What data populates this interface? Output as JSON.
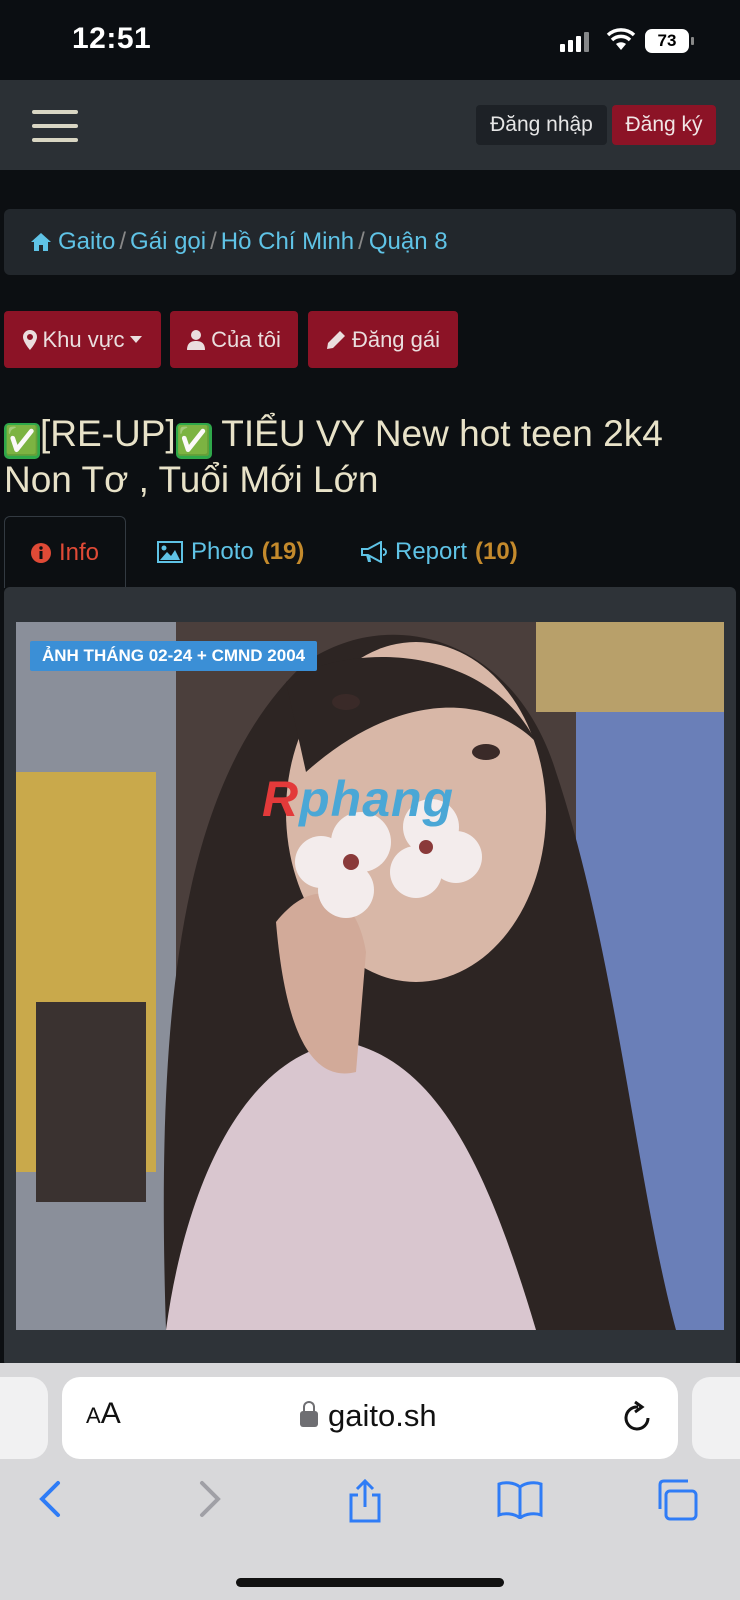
{
  "status_bar": {
    "time": "12:51",
    "battery": "73"
  },
  "navbar": {
    "login_label": "Đăng nhập",
    "register_label": "Đăng ký"
  },
  "breadcrumb": {
    "items": [
      "Gaito",
      "Gái gọi",
      "Hồ Chí Minh",
      "Quận 8"
    ]
  },
  "actions": {
    "area_label": "Khu vực",
    "mine_label": "Của tôi",
    "post_label": "Đăng gái"
  },
  "listing": {
    "title_badge_1": "✅",
    "title_part_1": "[RE-UP]",
    "title_badge_2": "✅",
    "title_part_2": " TIỂU VY New hot teen 2k4 Non Tơ , Tuổi Mới Lớn"
  },
  "tabs": [
    {
      "label": "Info",
      "count": ""
    },
    {
      "label": "Photo",
      "count": "(19)"
    },
    {
      "label": "Report",
      "count": "(10)"
    }
  ],
  "photo": {
    "badge": "ẢNH THÁNG 02-24 + CMND 2004",
    "watermark_a": "R",
    "watermark_b": "phang"
  },
  "browser": {
    "aa_small": "A",
    "aa_big": "A",
    "url": "gaito.sh"
  },
  "colors": {
    "accent": "#8c1326",
    "link": "#5fc3e6",
    "active_tab": "#e04a36",
    "count": "#c48a2c"
  }
}
